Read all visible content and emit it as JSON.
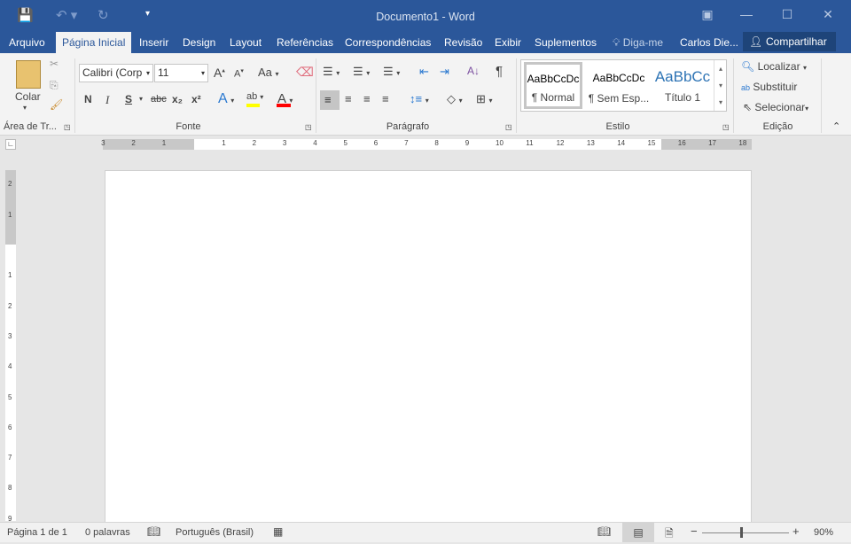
{
  "window": {
    "title": "Documento1 - Word"
  },
  "quick_access": {
    "save": "save-icon",
    "undo": "undo-icon",
    "redo": "redo-icon",
    "customize": "customize-icon"
  },
  "tabs": [
    "Arquivo",
    "Página Inicial",
    "Inserir",
    "Design",
    "Layout",
    "Referências",
    "Correspondências",
    "Revisão",
    "Exibir",
    "Suplementos"
  ],
  "active_tab": "Página Inicial",
  "tell_me": "Diga-me",
  "user": "Carlos Die...",
  "share": "Compartilhar",
  "ribbon": {
    "clipboard": {
      "label": "Área de Tr...",
      "paste": "Colar"
    },
    "font": {
      "label": "Fonte",
      "font_name": "Calibri (Corp",
      "font_size": "11",
      "change_case": "Aa",
      "bold": "N",
      "italic": "I",
      "underline": "S",
      "strike": "abc",
      "sub": "x₂",
      "sup": "x²",
      "highlight_color": "#ffff00",
      "font_color": "#ff0000"
    },
    "paragraph": {
      "label": "Parágrafo",
      "pilcrow": "¶"
    },
    "styles": {
      "label": "Estilo",
      "items": [
        {
          "preview": "AaBbCcDc",
          "name": "¶ Normal"
        },
        {
          "preview": "AaBbCcDc",
          "name": "¶ Sem Esp..."
        },
        {
          "preview": "AaBbCc",
          "name": "Título 1"
        }
      ]
    },
    "editing": {
      "label": "Edição",
      "find": "Localizar",
      "replace": "Substituir",
      "select": "Selecionar"
    }
  },
  "ruler": {
    "h_left": [
      "3",
      "2",
      "1"
    ],
    "h_right": [
      "1",
      "2",
      "3",
      "4",
      "5",
      "6",
      "7",
      "8",
      "9",
      "10",
      "11",
      "12",
      "13",
      "14",
      "15",
      "16",
      "17",
      "18"
    ],
    "v_top": [
      "2",
      "1"
    ],
    "v_bottom": [
      "1",
      "2",
      "3",
      "4",
      "5",
      "6",
      "7",
      "8",
      "9"
    ]
  },
  "status": {
    "page": "Página 1 de 1",
    "words": "0 palavras",
    "language": "Português (Brasil)",
    "zoom": "90%",
    "zoom_level_percent": 90
  },
  "colors": {
    "brand": "#2b579a"
  }
}
